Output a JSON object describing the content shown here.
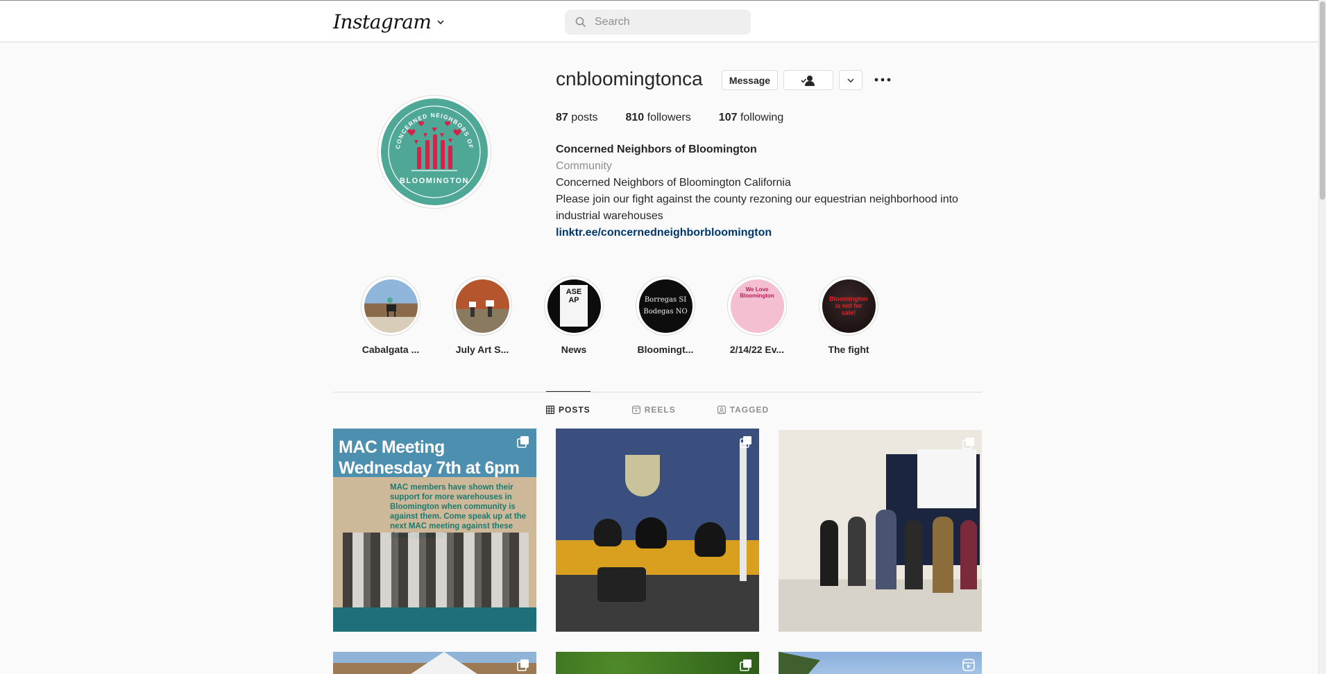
{
  "header": {
    "logo_text": "Instagram",
    "search_placeholder": "Search"
  },
  "profile": {
    "username": "cnbloomingtonca",
    "avatar_text_top": "CONCERNED NEIGHBORS OF",
    "avatar_text_bottom": "BLOOMINGTON",
    "buttons": {
      "message": "Message"
    },
    "stats": {
      "posts_count": "87",
      "posts_label": "posts",
      "followers_count": "810",
      "followers_label": "followers",
      "following_count": "107",
      "following_label": "following"
    },
    "bio": {
      "name": "Concerned Neighbors of Bloomington",
      "category": "Community",
      "line1": "Concerned Neighbors of Bloomington California",
      "line2": "Please join our fight against the county rezoning our equestrian neighborhood into industrial warehouses",
      "link": "linktr.ee/concernedneighborbloomington"
    }
  },
  "highlights": [
    {
      "label": "Cabalgata ...",
      "bg": "#8fa9c4"
    },
    {
      "label": "July Art S...",
      "bg": "#b5552e"
    },
    {
      "label": "News",
      "bg": "#2a2a2a",
      "img_text": "ASE AP"
    },
    {
      "label": "Bloomingt...",
      "bg": "#111111",
      "img_text": "Borregas SI Bodegas NO"
    },
    {
      "label": "2/14/22 Ev...",
      "bg": "#f2b8cc",
      "img_text": "We Love Bloomington"
    },
    {
      "label": "The fight",
      "bg": "#1a1212",
      "img_text": "Bloomington is not for sale!"
    }
  ],
  "tabs": [
    {
      "label": "POSTS",
      "active": true
    },
    {
      "label": "REELS",
      "active": false
    },
    {
      "label": "TAGGED",
      "active": false
    }
  ],
  "posts": [
    {
      "title_line1": "MAC Meeting",
      "title_line2": "Wednesday 7th at 6pm",
      "body": "MAC members have shown their support for more warehouses in Bloomington when community is against them. Come speak up at the next MAC meeting against these developments!"
    },
    {
      "caption": ""
    },
    {
      "caption": ""
    },
    {
      "caption": ""
    },
    {
      "caption": ""
    },
    {
      "caption": ""
    }
  ],
  "colors": {
    "accent_teal": "#4fa896",
    "accent_red": "#d6224a",
    "link_blue": "#00376b"
  }
}
